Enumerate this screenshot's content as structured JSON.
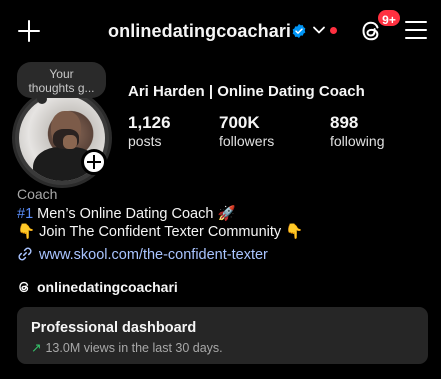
{
  "header": {
    "username": "onlinedatingcoachari",
    "badge_count": "9+"
  },
  "profile": {
    "note_line1": "Your",
    "note_line2": "thoughts g...",
    "full_name": "Ari Harden | Online Dating Coach",
    "stats": [
      {
        "value": "1,126",
        "label": "posts"
      },
      {
        "value": "700K",
        "label": "followers"
      },
      {
        "value": "898",
        "label": "following"
      }
    ]
  },
  "bio": {
    "category": "Coach",
    "line1_hash": "#1",
    "line1_text": " Men’s Online Dating Coach 🚀",
    "line2_text": "👇 Join The Confident Texter Community 👇",
    "link": "www.skool.com/the-confident-texter",
    "threads_handle": "onlinedatingcoachari"
  },
  "dashboard": {
    "title": "Professional dashboard",
    "subtitle": "13.0M views in the last 30 days.",
    "arrow": "↗"
  },
  "colors": {
    "background": "#000000",
    "accent_red": "#ff3040",
    "link_blue": "#a9c4ff",
    "verified_blue": "#0095f6",
    "trend_green": "#36c56b"
  },
  "icons": [
    "plus-icon",
    "verified-icon",
    "chevron-down-icon",
    "threads-icon",
    "menu-icon",
    "link-icon",
    "add-story-icon",
    "trend-up-icon"
  ]
}
